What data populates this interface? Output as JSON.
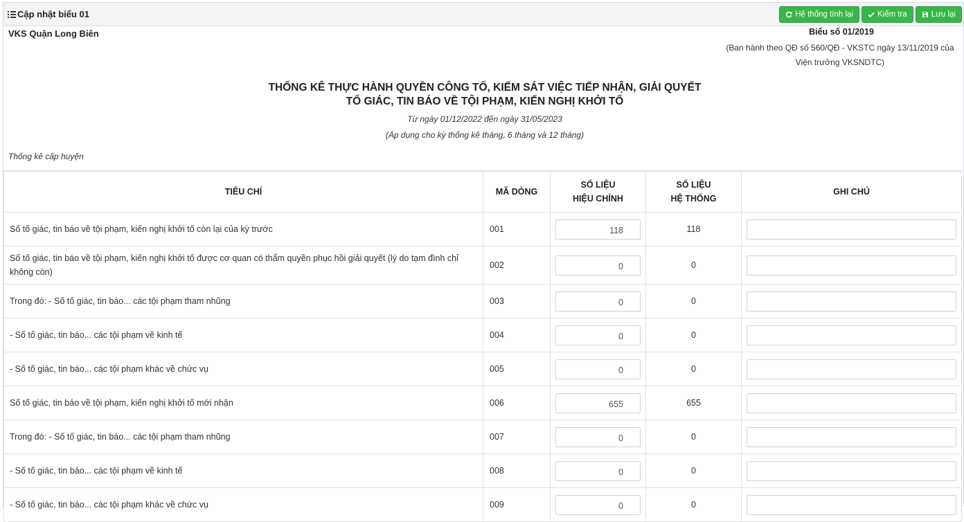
{
  "header": {
    "title": "Cập nhật biểu 01",
    "buttons": {
      "recalc": "Hệ thống tính lại",
      "check": "Kiểm tra",
      "save": "Lưu lại"
    }
  },
  "report": {
    "org": "VKS Quận Long Biên",
    "form_no": "Biểu số 01/2019",
    "issued_by_line1": "(Ban hành theo QĐ số 560/QĐ - VKSTC ngày 13/11/2019 của",
    "issued_by_line2": "Viện trưởng VKSNDTC)",
    "title_line1": "THỐNG KÊ THỰC HÀNH QUYỀN CÔNG TỐ, KIẾM SÁT VIỆC TIẾP NHẬN, GIẢI QUYẾT",
    "title_line2": "TỐ GIÁC, TIN BÁO VỀ TỘI PHẠM, KIẾN NGHỊ KHỞI TỐ",
    "period": "Từ ngày 01/12/2022 đến ngày 31/05/2023",
    "apply": "(Áp dụng cho kỳ thống kê tháng, 6 tháng và 12 tháng)",
    "level": "Thống kê cấp huyện"
  },
  "table": {
    "columns": {
      "criteria": "TIÊU CHÍ",
      "code": "MÃ DÒNG",
      "adjusted_l1": "SỐ LIỆU",
      "adjusted_l2": "HIỆU CHỈNH",
      "system_l1": "SỐ LIỆU",
      "system_l2": "HỆ THỐNG",
      "note": "GHI CHÚ"
    },
    "rows": [
      {
        "criteria": "Số tố giác, tin báo về tội phạm, kiến nghị khởi tố còn lại của kỳ trước",
        "code": "001",
        "adjusted": "118",
        "system": "118",
        "note": ""
      },
      {
        "criteria": "Số tố giác, tin báo về tội phạm, kiến nghị khởi tố được cơ quan có thẩm quyền phục hồi giải quyết (lý do tạm đình chỉ không còn)",
        "code": "002",
        "adjusted": "0",
        "system": "0",
        "note": ""
      },
      {
        "criteria": "Trong đó: - Số tố giác, tin báo... các tội phạm tham nhũng",
        "code": "003",
        "adjusted": "0",
        "system": "0",
        "note": ""
      },
      {
        "criteria": "- Số tố giác, tin báo... các tội phạm về kinh tế",
        "code": "004",
        "adjusted": "0",
        "system": "0",
        "note": ""
      },
      {
        "criteria": "- Số tố giác, tin báo... các tội phạm khác về chức vụ",
        "code": "005",
        "adjusted": "0",
        "system": "0",
        "note": ""
      },
      {
        "criteria": "Số tố giác, tin báo về tội phạm, kiến nghị khởi tố mới nhận",
        "code": "006",
        "adjusted": "655",
        "system": "655",
        "note": ""
      },
      {
        "criteria": "Trong đó: - Số tố giác, tin báo... các tội phạm tham nhũng",
        "code": "007",
        "adjusted": "0",
        "system": "0",
        "note": ""
      },
      {
        "criteria": "- Số tố giác, tin báo... các tội phạm về kinh tế",
        "code": "008",
        "adjusted": "0",
        "system": "0",
        "note": ""
      },
      {
        "criteria": "- Số tố giác, tin báo... các tội phạm khác về chức vụ",
        "code": "009",
        "adjusted": "0",
        "system": "0",
        "note": ""
      }
    ]
  }
}
